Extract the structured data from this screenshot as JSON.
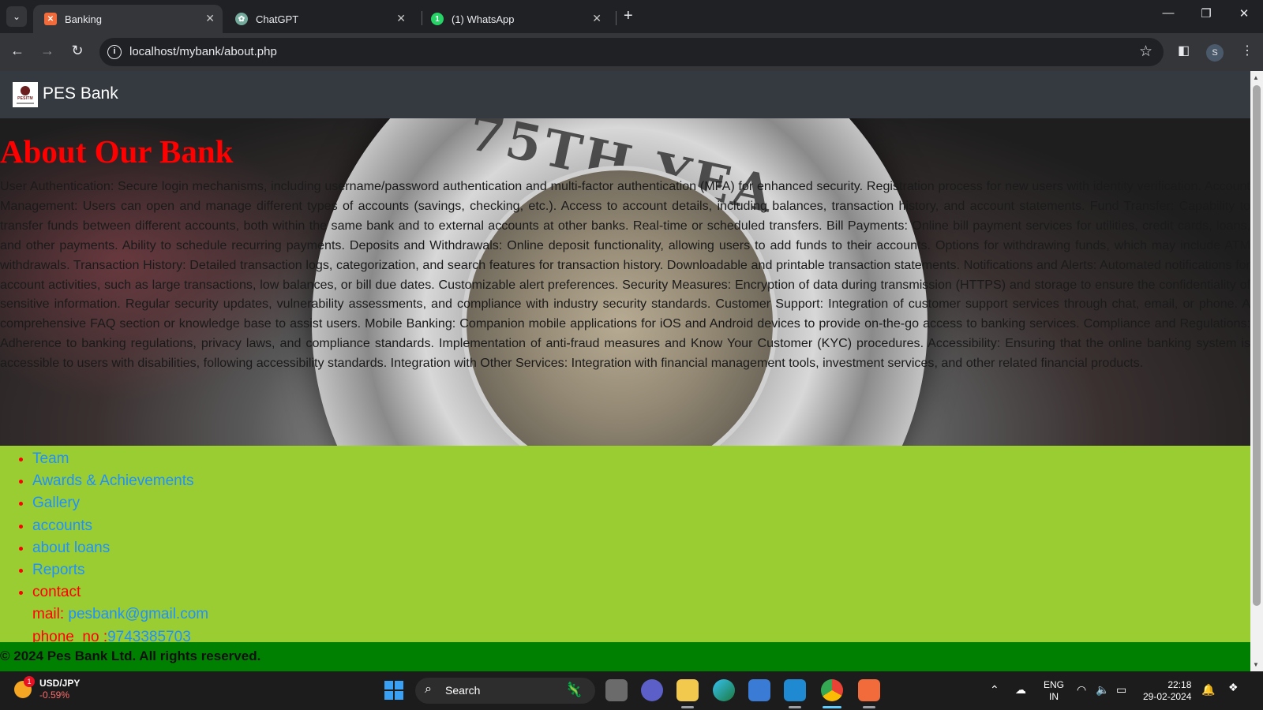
{
  "browser": {
    "tabs": [
      {
        "title": "Banking",
        "active": true
      },
      {
        "title": "ChatGPT",
        "active": false
      },
      {
        "title": "(1) WhatsApp",
        "active": false
      }
    ],
    "url": "localhost/mybank/about.php",
    "profile_initial": "S"
  },
  "page": {
    "brand": "PES Bank",
    "logo_text": "PESITM",
    "heading": "About Our Bank",
    "about_text": "User Authentication: Secure login mechanisms, including username/password authentication and multi-factor authentication (MFA) for enhanced security. Registration process for new users with identity verification. Account Management: Users can open and manage different types of accounts (savings, checking, etc.). Access to account details, including balances, transaction history, and account statements. Fund Transfer: Capability to transfer funds between different accounts, both within the same bank and to external accounts at other banks. Real-time or scheduled transfers. Bill Payments: Online bill payment services for utilities, credit cards, loans, and other payments. Ability to schedule recurring payments. Deposits and Withdrawals: Online deposit functionality, allowing users to add funds to their accounts. Options for withdrawing funds, which may include ATM withdrawals. Transaction History: Detailed transaction logs, categorization, and search features for transaction history. Downloadable and printable transaction statements. Notifications and Alerts: Automated notifications for account activities, such as large transactions, low balances, or bill due dates. Customizable alert preferences. Security Measures: Encryption of data during transmission (HTTPS) and storage to ensure the confidentiality of sensitive information. Regular security updates, vulnerability assessments, and compliance with industry security standards. Customer Support: Integration of customer support services through chat, email, or phone. A comprehensive FAQ section or knowledge base to assist users. Mobile Banking: Companion mobile applications for iOS and Android devices to provide on-the-go access to banking services. Compliance and Regulations: Adherence to banking regulations, privacy laws, and compliance standards. Implementation of anti-fraud measures and Know Your Customer (KYC) procedures. Accessibility: Ensuring that the online banking system is accessible to users with disabilities, following accessibility standards. Integration with Other Services: Integration with financial management tools, investment services, and other related financial products.",
    "hero_coin_text": "75TH YEA",
    "links": [
      "Team",
      "Awards & Achievements",
      "Gallery",
      "accounts",
      "about loans",
      "Reports"
    ],
    "contact": {
      "label": "contact",
      "mail_label": "mail: ",
      "mail": "pesbank@gmail.com",
      "phone_label": "phone_no :",
      "phone": "9743385703"
    },
    "footer": "© 2024 Pes Bank Ltd. All rights reserved."
  },
  "taskbar": {
    "ticker_symbol": "USD/JPY",
    "ticker_change": "-0.59%",
    "ticker_badge": "1",
    "search_placeholder": "Search",
    "lang_line1": "ENG",
    "lang_line2": "IN",
    "time": "22:18",
    "date": "29-02-2024"
  },
  "colors": {
    "heading": "#ff0000",
    "links_panel": "#9acd32",
    "link": "#1e90ff",
    "footer": "#008000",
    "navbar": "#343a40"
  }
}
